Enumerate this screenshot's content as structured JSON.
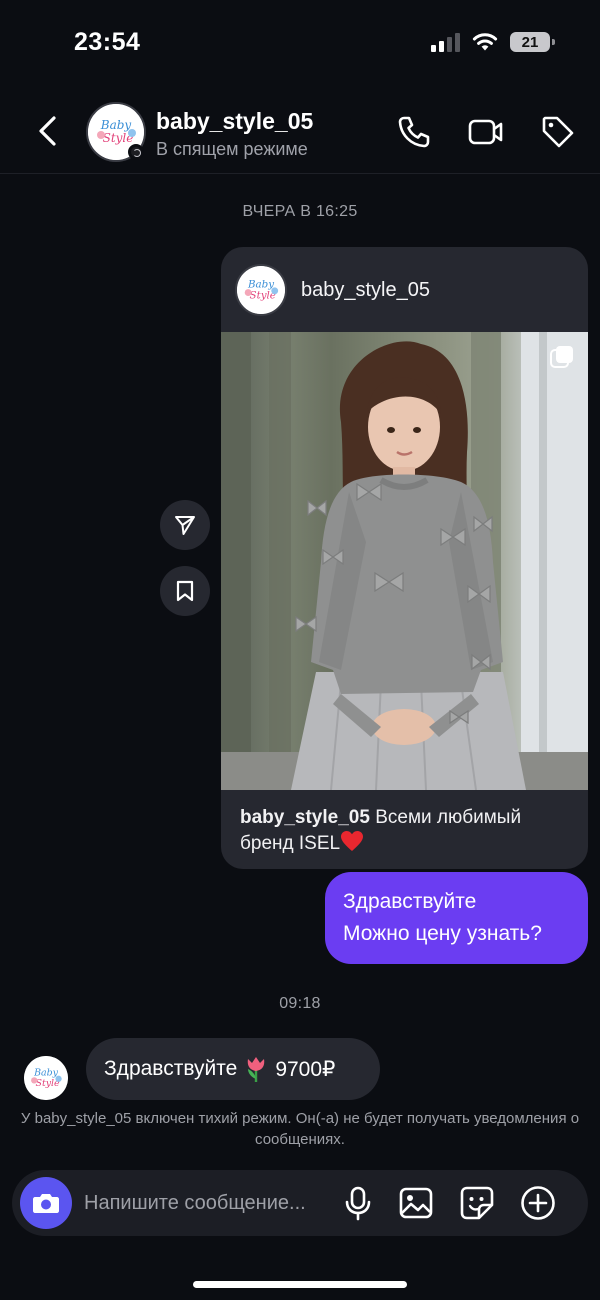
{
  "status_bar": {
    "time": "23:54",
    "battery": "21",
    "icons": [
      "signal-icon",
      "wifi-icon",
      "battery-icon"
    ]
  },
  "header": {
    "name": "baby_style_05",
    "status": "В спящем режиме",
    "avatar_logo_text": "Baby Style",
    "actions": [
      "back-icon",
      "phone-icon",
      "video-icon",
      "tag-icon"
    ]
  },
  "messages": {
    "date_1": "ВЧЕРА В 16:25",
    "shared_post": {
      "author": "baby_style_05",
      "caption_user": "baby_style_05",
      "caption_text": "Всеми любимый бренд ISEL",
      "caption_emoji": "heart-emoji",
      "side_actions": [
        "send-icon",
        "bookmark-icon"
      ],
      "multi_image_icon": "carousel-icon"
    },
    "outgoing": {
      "line_1": "Здравствуйте",
      "line_2": "Можно цену узнать?"
    },
    "date_2": "09:18",
    "incoming": {
      "text": "Здравствуйте",
      "emoji": "tulip-emoji",
      "price": "9700₽"
    },
    "notice": "У baby_style_05 включен тихий режим. Он(-а) не будет получать уведомления о сообщениях."
  },
  "composer": {
    "placeholder": "Напишите сообщение...",
    "actions": [
      "camera-icon",
      "mic-icon",
      "gallery-icon",
      "sticker-icon",
      "plus-icon"
    ]
  },
  "colors": {
    "background": "#0b0d12",
    "bubble_outgoing": "#6b3df2",
    "bubble_incoming": "#262830",
    "camera_button": "#5b55f0",
    "secondary_text": "#9ea0a7"
  }
}
